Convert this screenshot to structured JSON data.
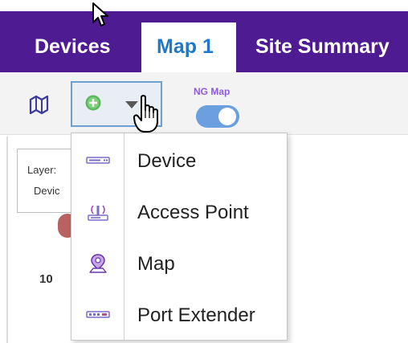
{
  "tabs": {
    "devices": "Devices",
    "map": "Map 1",
    "summary": "Site Summary"
  },
  "toolbar": {
    "ng_map_label": "NG Map",
    "ng_map_on": true
  },
  "layer_panel": {
    "title": "Layer:",
    "value": "Devic"
  },
  "canvas": {
    "node_label": "10"
  },
  "add_menu": {
    "items": [
      {
        "label": "Device",
        "icon": "device-icon"
      },
      {
        "label": "Access Point",
        "icon": "access-point-icon"
      },
      {
        "label": "Map",
        "icon": "map-pin-icon"
      },
      {
        "label": "Port Extender",
        "icon": "port-extender-icon"
      }
    ]
  },
  "colors": {
    "nav_bg": "#4e1b92",
    "active_tab_text": "#1f79c8",
    "ng_map_text": "#8e5ad8",
    "toggle_on": "#6b9fe0",
    "add_icon": "#5cb85c"
  }
}
